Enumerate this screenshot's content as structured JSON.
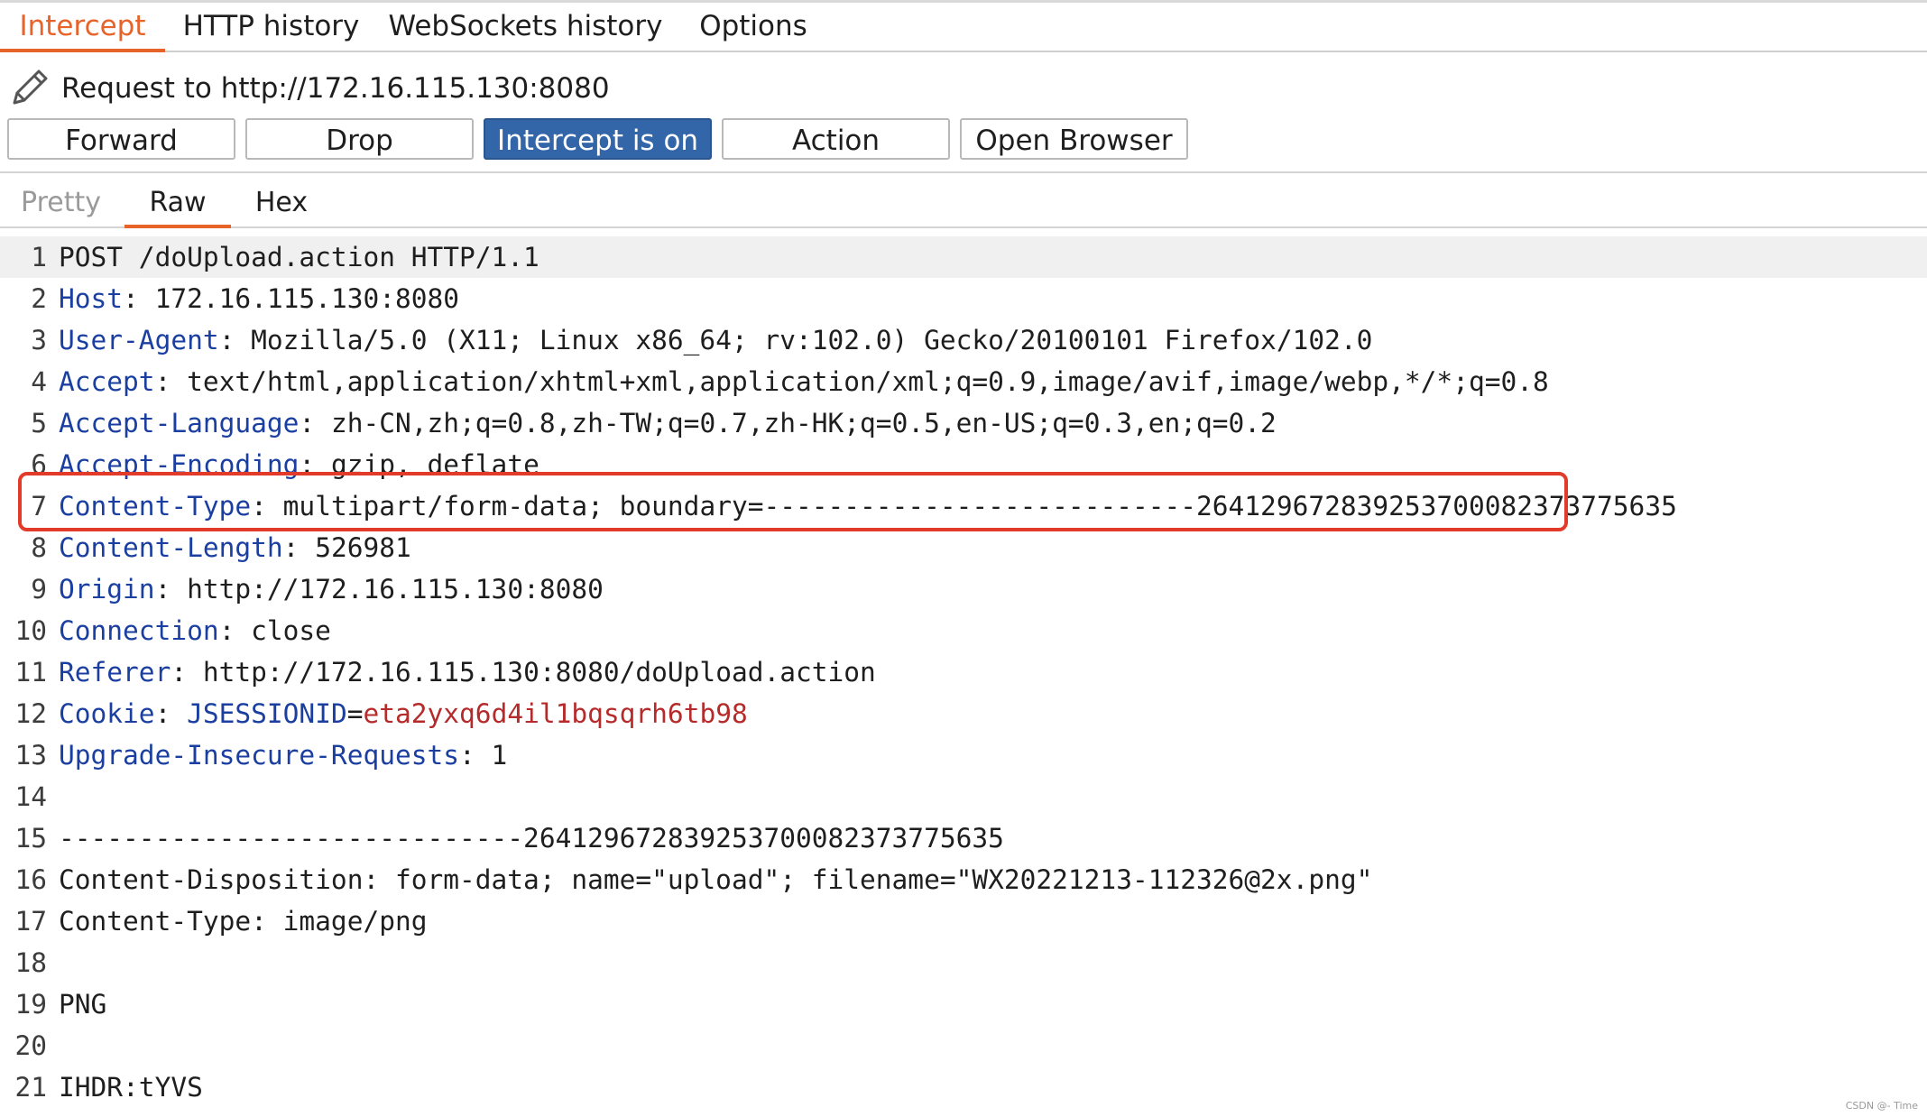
{
  "tabs": {
    "intercept": "Intercept",
    "http_history": "HTTP history",
    "websockets_history": "WebSockets history",
    "options": "Options"
  },
  "request": {
    "label": "Request to http://172.16.115.130:8080"
  },
  "buttons": {
    "forward": "Forward",
    "drop": "Drop",
    "intercept": "Intercept is on",
    "action": "Action",
    "open_browser": "Open Browser"
  },
  "view_tabs": {
    "pretty": "Pretty",
    "raw": "Raw",
    "hex": "Hex"
  },
  "lines": [
    {
      "n": "1",
      "name": "",
      "sep": "",
      "value": "POST /doUpload.action HTTP/1.1"
    },
    {
      "n": "2",
      "name": "Host",
      "sep": ": ",
      "value": "172.16.115.130:8080"
    },
    {
      "n": "3",
      "name": "User-Agent",
      "sep": ": ",
      "value": "Mozilla/5.0 (X11; Linux x86_64; rv:102.0) Gecko/20100101 Firefox/102.0"
    },
    {
      "n": "4",
      "name": "Accept",
      "sep": ": ",
      "value": "text/html,application/xhtml+xml,application/xml;q=0.9,image/avif,image/webp,*/*;q=0.8"
    },
    {
      "n": "5",
      "name": "Accept-Language",
      "sep": ": ",
      "value": "zh-CN,zh;q=0.8,zh-TW;q=0.7,zh-HK;q=0.5,en-US;q=0.3,en;q=0.2"
    },
    {
      "n": "6",
      "name": "Accept-Encoding",
      "sep": ": ",
      "value": "gzip, deflate"
    },
    {
      "n": "7",
      "name": "Content-Type",
      "sep": ": ",
      "value": "multipart/form-data; boundary=---------------------------264129672839253700082373775635"
    },
    {
      "n": "8",
      "name": "Content-Length",
      "sep": ": ",
      "value": "526981"
    },
    {
      "n": "9",
      "name": "Origin",
      "sep": ": ",
      "value": "http://172.16.115.130:8080"
    },
    {
      "n": "10",
      "name": "Connection",
      "sep": ": ",
      "value": "close"
    },
    {
      "n": "11",
      "name": "Referer",
      "sep": ": ",
      "value": "http://172.16.115.130:8080/doUpload.action"
    },
    {
      "n": "12",
      "name": "Cookie",
      "sep": ": ",
      "value": "",
      "cookie_name": "JSESSIONID",
      "cookie_eq": "=",
      "cookie_value": "eta2yxq6d4il1bqsqrh6tb98"
    },
    {
      "n": "13",
      "name": "Upgrade-Insecure-Requests",
      "sep": ": ",
      "value": "1"
    },
    {
      "n": "14",
      "name": "",
      "sep": "",
      "value": ""
    },
    {
      "n": "15",
      "name": "",
      "sep": "",
      "value": "-----------------------------264129672839253700082373775635"
    },
    {
      "n": "16",
      "name": "",
      "sep": "",
      "value": "Content-Disposition: form-data; name=\"upload\"; filename=\"WX20221213-112326@2x.png\""
    },
    {
      "n": "17",
      "name": "",
      "sep": "",
      "value": "Content-Type: image/png"
    },
    {
      "n": "18",
      "name": "",
      "sep": "",
      "value": ""
    },
    {
      "n": "19",
      "name": "",
      "sep": "",
      "value": "PNG"
    },
    {
      "n": "20",
      "name": "",
      "sep": "",
      "value": ""
    },
    {
      "n": "21",
      "name": "",
      "sep": "",
      "value": "IHDR:tYVS"
    }
  ],
  "watermark": "CSDN @- Time",
  "colors": {
    "accent": "#e8632a",
    "button_on": "#3366a8",
    "header_name": "#1a3fa0",
    "cookie_value": "#b52a2a",
    "highlight_box": "#e23b2a"
  }
}
